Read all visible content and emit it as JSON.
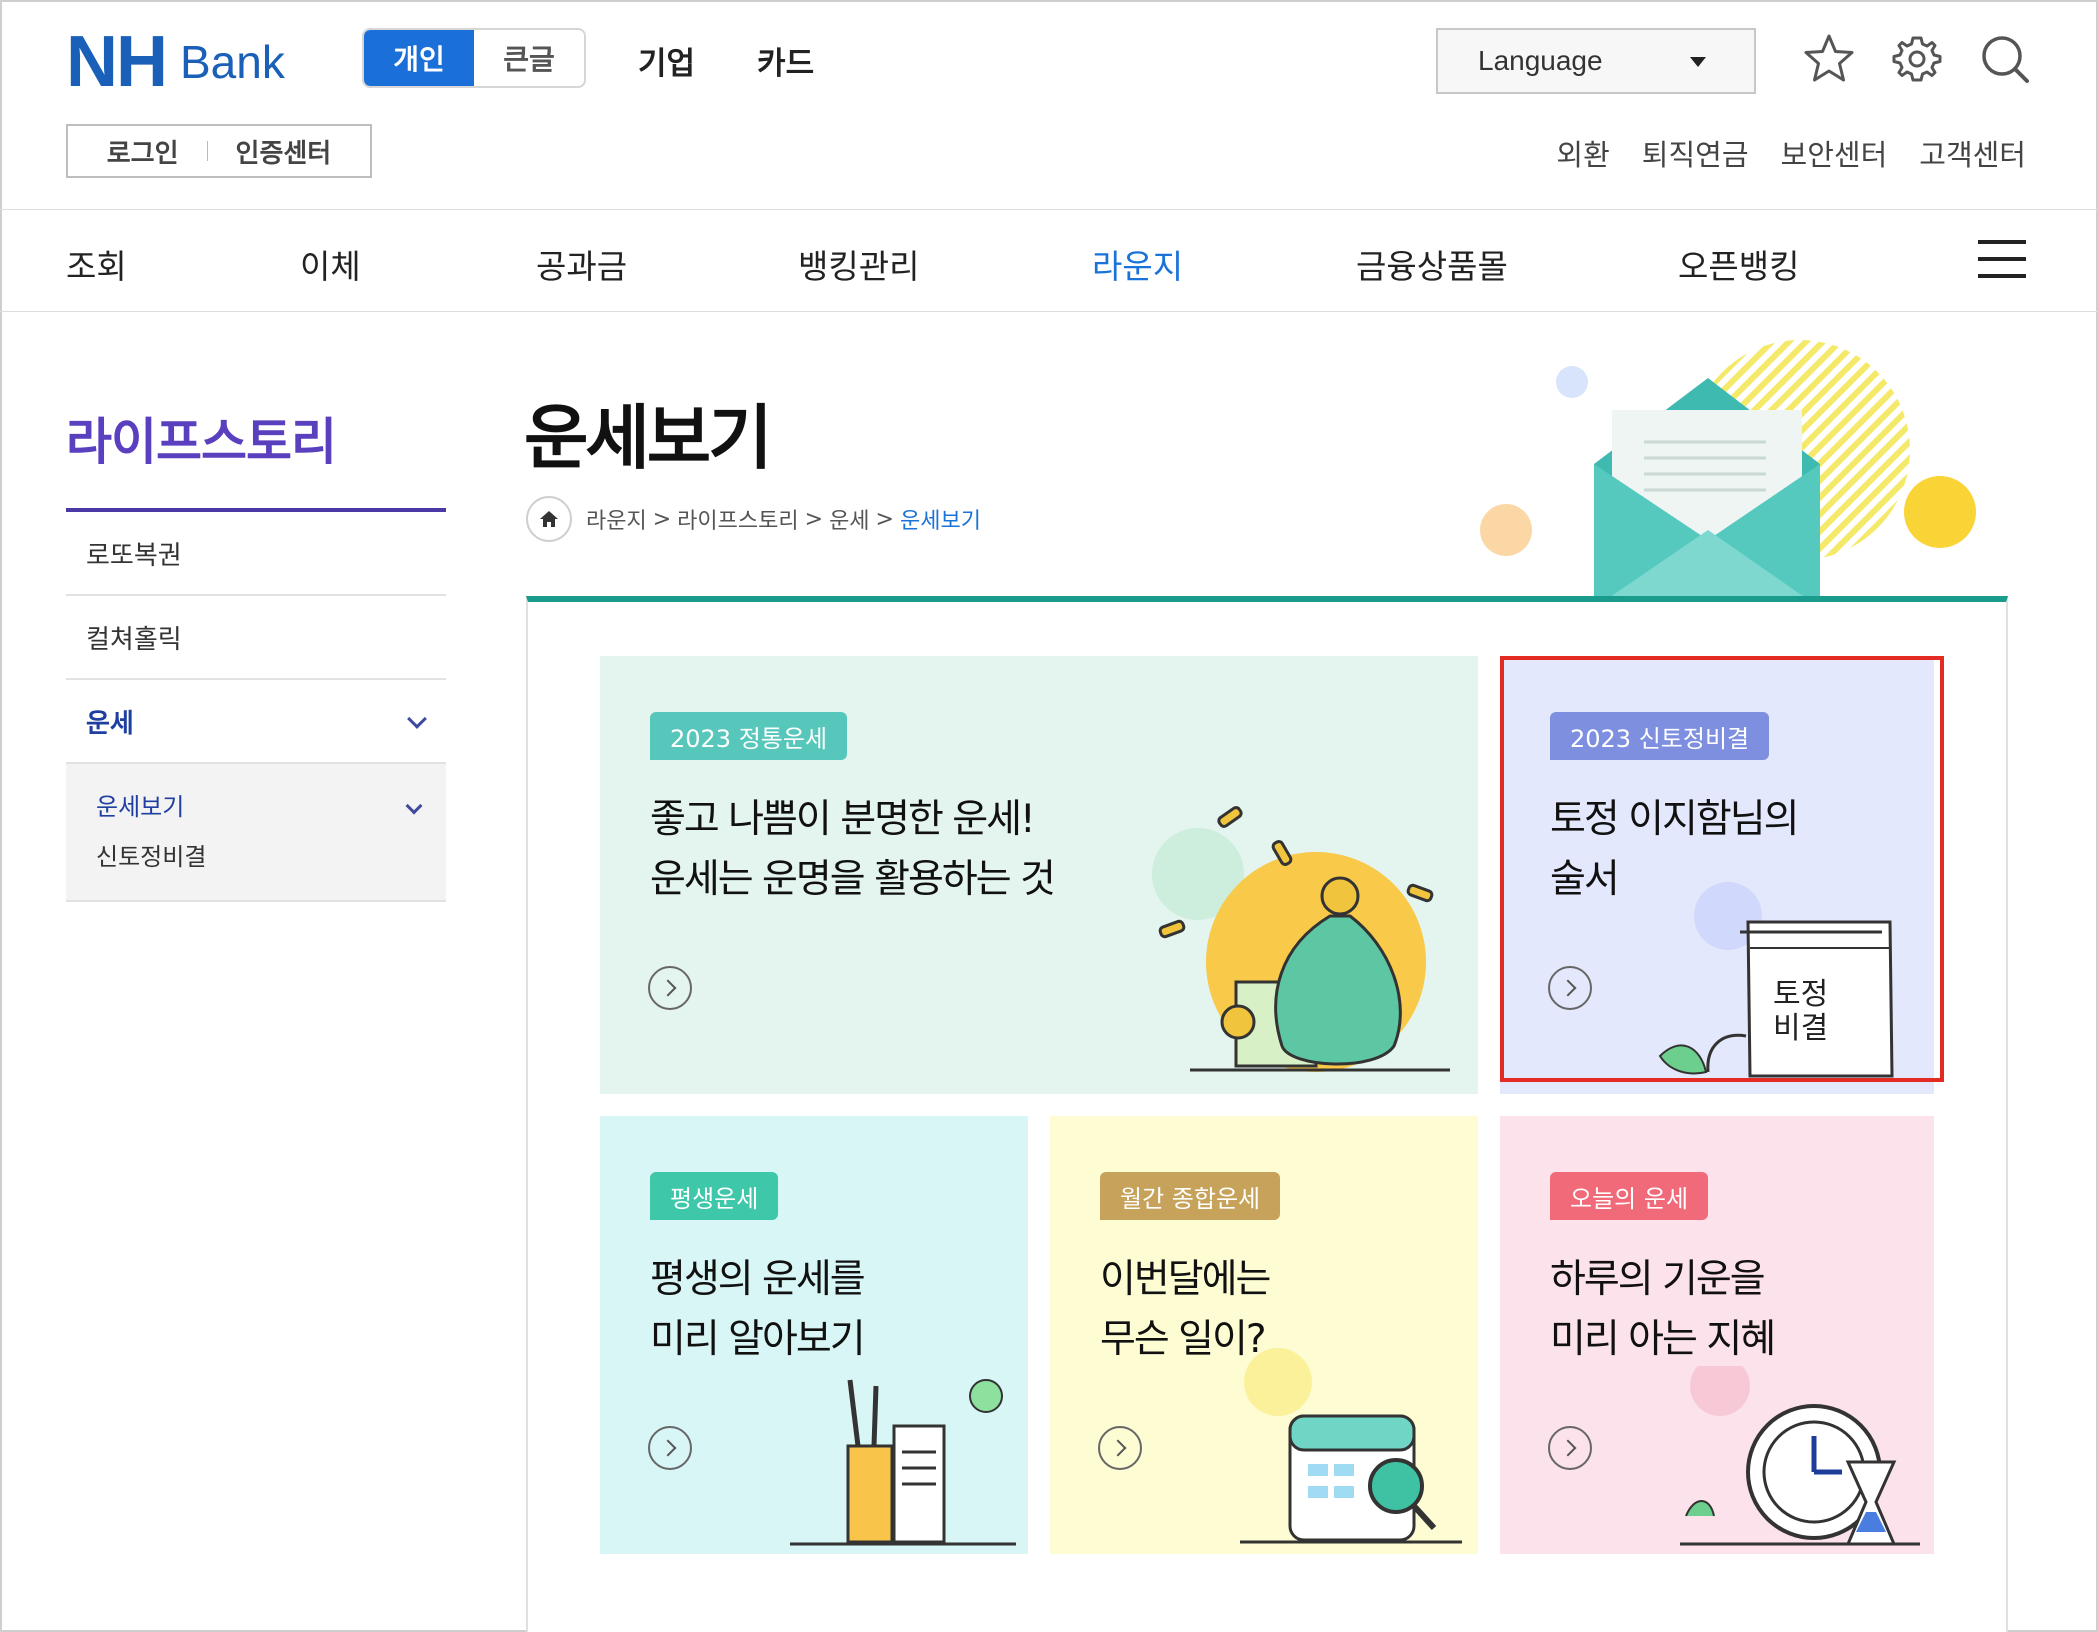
{
  "header": {
    "logo_nh": "NH",
    "logo_bank": "Bank",
    "mode_options": [
      "개인",
      "큰글"
    ],
    "top_links": [
      "기업",
      "카드"
    ],
    "login": "로그인",
    "cert_center": "인증센터",
    "language": "Language",
    "util_links": [
      "외환",
      "퇴직연금",
      "보안센터",
      "고객센터"
    ]
  },
  "gnb": {
    "items": [
      "조회",
      "이체",
      "공과금",
      "뱅킹관리",
      "라운지",
      "금융상품몰",
      "오픈뱅킹"
    ],
    "active": "라운지"
  },
  "sidebar": {
    "title": "라이프스토리",
    "items": [
      "로또복권",
      "컬쳐홀릭",
      "운세"
    ],
    "sub_items": [
      "운세보기",
      "신토정비결"
    ]
  },
  "main": {
    "title": "운세보기",
    "breadcrumb": [
      "라운지",
      "라이프스토리",
      "운세",
      "운세보기"
    ],
    "breadcrumb_sep": ">"
  },
  "cards": [
    {
      "tag": "2023 정통운세",
      "desc": "좋고 나쁨이 분명한 운세!\n운세는 운명을 활용하는 것",
      "tag_color": "#57c7bb",
      "bg": "#e4f4ee"
    },
    {
      "tag": "2023 신토정비결",
      "desc": "토정 이지함님의\n술서",
      "tag_color": "#7e8fe0",
      "bg": "#e4e8fc",
      "book_label": "토정\n비결"
    },
    {
      "tag": "평생운세",
      "desc": "평생의 운세를\n미리 알아보기",
      "tag_color": "#3ec7a8",
      "bg": "#d9f6f6"
    },
    {
      "tag": "월간 종합운세",
      "desc": "이번달에는\n무슨 일이?",
      "tag_color": "#c7a25a",
      "bg": "#fdfcd2"
    },
    {
      "tag": "오늘의 운세",
      "desc": "하루의 기운을\n미리 아는 지혜",
      "tag_color": "#f06a7a",
      "bg": "#fce2ea"
    }
  ],
  "icons": [
    "star-icon",
    "gear-icon",
    "search-icon",
    "menu-icon",
    "home-icon"
  ],
  "colors": {
    "brand": "#1a5fb8",
    "accent": "#1a73d9",
    "highlight": "#e32a23",
    "teal": "#1a9c8d"
  }
}
